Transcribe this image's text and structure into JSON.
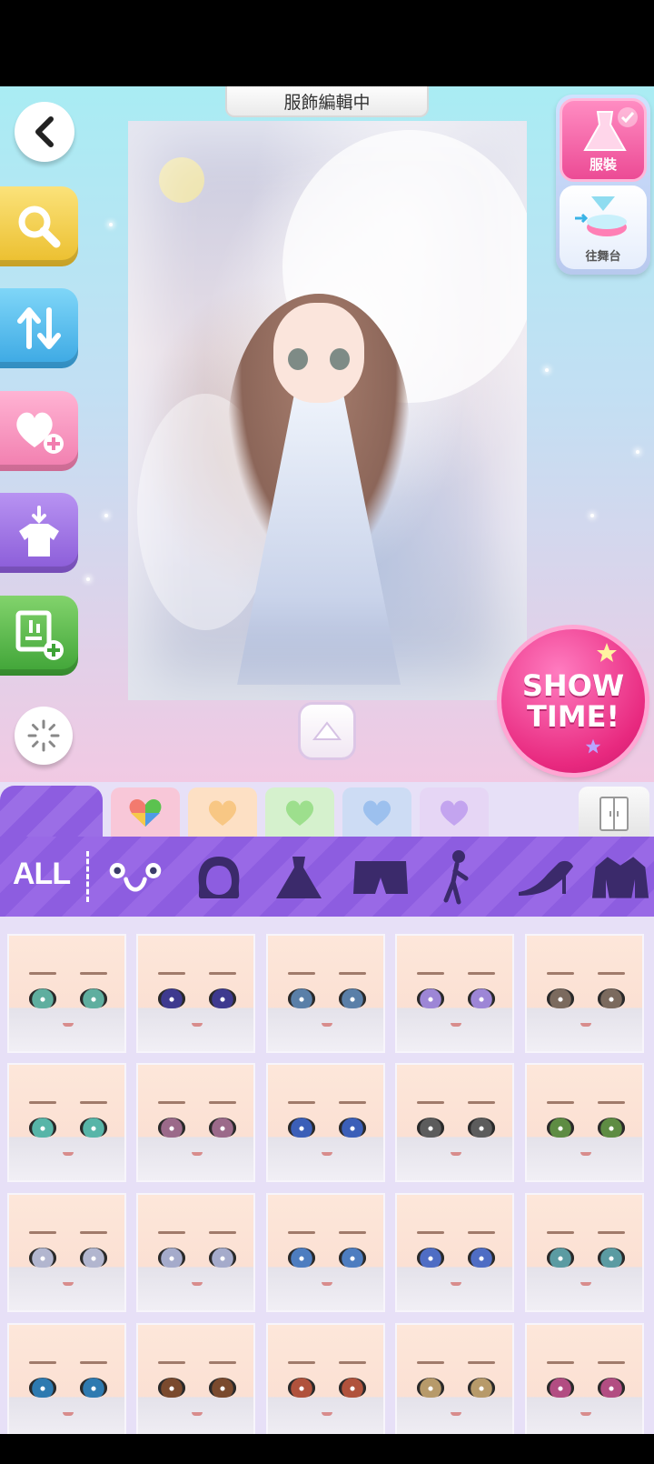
{
  "header": {
    "title": "服飾編輯中"
  },
  "side_buttons": [
    {
      "name": "search",
      "icon": "search-icon"
    },
    {
      "name": "sort",
      "icon": "sort-icon"
    },
    {
      "name": "add-favorite",
      "icon": "heart-plus-icon"
    },
    {
      "name": "wear-outfit",
      "icon": "shirt-download-icon"
    },
    {
      "name": "add-slot",
      "icon": "frame-plus-icon"
    }
  ],
  "category_switch": {
    "costume_label": "服裝",
    "stage_label": "往舞台"
  },
  "showtime": {
    "line1": "SHOW",
    "line2": "TIME!"
  },
  "filter_tabs": {
    "all_label": "ALL",
    "colors": [
      "#f8c7d8",
      "#fde0c4",
      "#d5f1cd",
      "#cddcf4",
      "#e6d6f5"
    ],
    "accent": "#8d5de0"
  },
  "categories": [
    "face",
    "hair",
    "dress",
    "bottoms",
    "pose",
    "shoes",
    "coat"
  ],
  "faces": [
    {
      "eye": "#5fae9f"
    },
    {
      "eye": "#3e3a8f"
    },
    {
      "eye": "#5a7fa8"
    },
    {
      "eye": "#9d86d6"
    },
    {
      "eye": "#7b6a5e"
    },
    {
      "eye": "#57b5a8"
    },
    {
      "eye": "#9b6a8a"
    },
    {
      "eye": "#3b5fb8"
    },
    {
      "eye": "#5c5c5c"
    },
    {
      "eye": "#5e8c43"
    },
    {
      "eye": "#b2b6cf"
    },
    {
      "eye": "#a5abcb"
    },
    {
      "eye": "#4d7dc0"
    },
    {
      "eye": "#4f6dc4"
    },
    {
      "eye": "#5b9ba2"
    },
    {
      "eye": "#2e7ab0"
    },
    {
      "eye": "#7a4a2e"
    },
    {
      "eye": "#b0523c"
    },
    {
      "eye": "#b79a6a"
    },
    {
      "eye": "#b24d82"
    }
  ]
}
